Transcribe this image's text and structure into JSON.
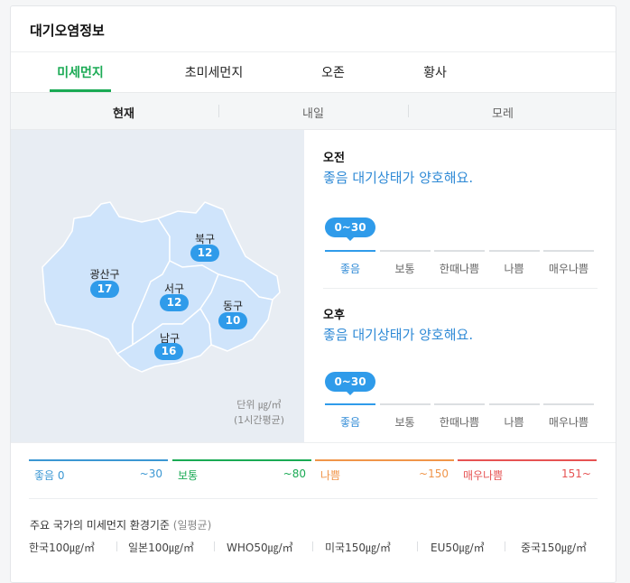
{
  "widget": {
    "title": "대기오염정보"
  },
  "tabs": [
    {
      "label": "미세먼지",
      "active": true
    },
    {
      "label": "초미세먼지",
      "active": false
    },
    {
      "label": "오존",
      "active": false
    },
    {
      "label": "황사",
      "active": false
    }
  ],
  "days": [
    {
      "label": "현재",
      "active": true
    },
    {
      "label": "내일",
      "active": false
    },
    {
      "label": "모레",
      "active": false
    }
  ],
  "map": {
    "districts": [
      {
        "name": "광산구",
        "value": "17"
      },
      {
        "name": "북구",
        "value": "12"
      },
      {
        "name": "서구",
        "value": "12"
      },
      {
        "name": "동구",
        "value": "10"
      },
      {
        "name": "남구",
        "value": "16"
      }
    ],
    "unit_line1": "단위 ㎍/㎥",
    "unit_line2": "(1시간평균)",
    "colors": {
      "region_fill": "#cfe4fb",
      "region_stroke": "#ffffff",
      "badge": "#2f9bea",
      "background": "#e8edf3"
    }
  },
  "forecast": {
    "morning": {
      "period": "오전",
      "status": "좋음  대기상태가 양호해요.",
      "range": "0~30",
      "level_index": 0
    },
    "afternoon": {
      "period": "오후",
      "status": "좋음  대기상태가 양호해요.",
      "range": "0~30",
      "level_index": 0
    },
    "levels": [
      "좋음",
      "보통",
      "한때나쁨",
      "나쁨",
      "매우나쁨"
    ]
  },
  "legend": [
    {
      "name": "좋음 0",
      "value": "~30",
      "color": "#3b97d3"
    },
    {
      "name": "보통",
      "value": "~80",
      "color": "#1aaa54"
    },
    {
      "name": "나쁨",
      "value": "~150",
      "color": "#f0954a"
    },
    {
      "name": "매우나쁨",
      "value": "151~",
      "color": "#e65353"
    }
  ],
  "standards": {
    "title": "주요 국가의 미세먼지 환경기준",
    "subtitle": "(일평균)",
    "items": [
      "한국100㎍/㎥",
      "일본100㎍/㎥",
      "WHO50㎍/㎥",
      "미국150㎍/㎥",
      "EU50㎍/㎥",
      "중국150㎍/㎥"
    ]
  }
}
